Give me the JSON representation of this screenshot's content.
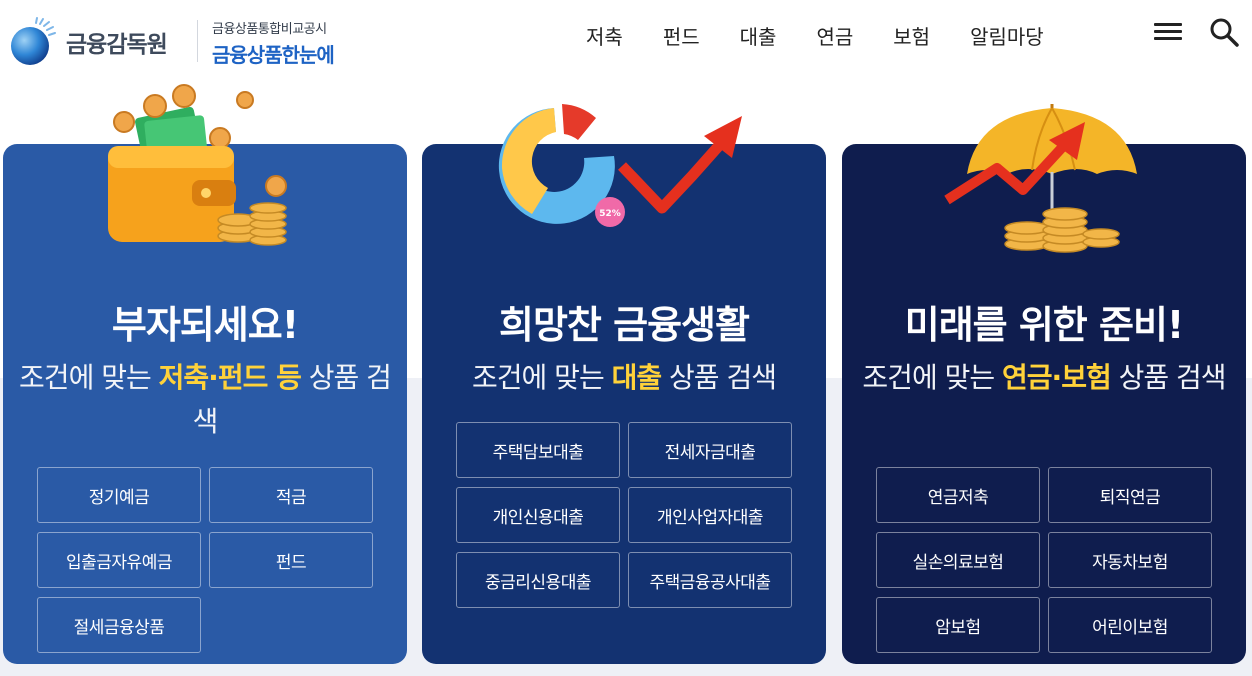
{
  "header": {
    "logo_text": "금융감독원",
    "subbrand_top": "금융상품통합비교공시",
    "subbrand_main": "금융상품한눈에",
    "nav": [
      "저축",
      "펀드",
      "대출",
      "연금",
      "보험",
      "알림마당"
    ],
    "menu_icon": "hamburger-menu-icon",
    "search_icon": "search-icon"
  },
  "cards": [
    {
      "title": "부자되세요!",
      "desc_prefix": "조건에 맞는 ",
      "desc_highlight": "저축·펀드 등",
      "desc_suffix": " 상품 검색",
      "illustration": "wallet-coins-icon",
      "color": "#2a5aa6",
      "buttons": [
        "정기예금",
        "적금",
        "입출금자유예금",
        "펀드",
        "절세금융상품"
      ]
    },
    {
      "title": "희망찬 금융생활",
      "desc_prefix": "조건에 맞는 ",
      "desc_highlight": "대출",
      "desc_suffix": " 상품 검색",
      "illustration": "donut-chart-arrow-icon",
      "badge": "52%",
      "color": "#133271",
      "buttons": [
        "주택담보대출",
        "전세자금대출",
        "개인신용대출",
        "개인사업자대출",
        "중금리신용대출",
        "주택금융공사대출"
      ]
    },
    {
      "title": "미래를 위한 준비!",
      "desc_prefix": "조건에 맞는 ",
      "desc_highlight": "연금·보험",
      "desc_suffix": " 상품 검색",
      "illustration": "umbrella-coins-icon",
      "color": "#0f1d4e",
      "buttons": [
        "연금저축",
        "퇴직연금",
        "실손의료보험",
        "자동차보험",
        "암보험",
        "어린이보험"
      ]
    }
  ],
  "colors": {
    "highlight": "#ffd23a",
    "brand_blue": "#1e63c4"
  }
}
